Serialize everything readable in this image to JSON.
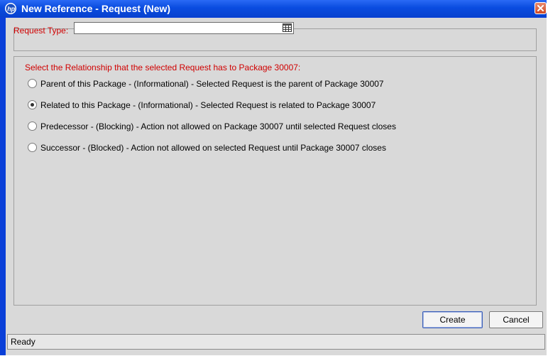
{
  "window": {
    "title": "New Reference - Request (New)"
  },
  "request_type": {
    "label": "Request Type:",
    "value": ""
  },
  "relationship": {
    "heading": "Select the Relationship that the selected Request has to Package 30007:",
    "options": [
      {
        "label": "Parent of this Package - (Informational) - Selected Request is the parent of Package 30007",
        "checked": false
      },
      {
        "label": "Related to this Package - (Informational) - Selected Request is related to Package 30007",
        "checked": true
      },
      {
        "label": "Predecessor - (Blocking) - Action not allowed on Package 30007 until selected Request closes",
        "checked": false
      },
      {
        "label": "Successor - (Blocked) - Action not allowed on selected Request until Package 30007 closes",
        "checked": false
      }
    ]
  },
  "buttons": {
    "create": "Create",
    "cancel": "Cancel"
  },
  "status": {
    "text": "Ready"
  },
  "colors": {
    "title_bar": "#0a4ce0",
    "label_red": "#d00000",
    "panel_bg": "#d9d9d9"
  },
  "icons": {
    "title_logo": "hp-logo-icon",
    "close": "close-icon",
    "lookup": "lookup-list-icon"
  }
}
